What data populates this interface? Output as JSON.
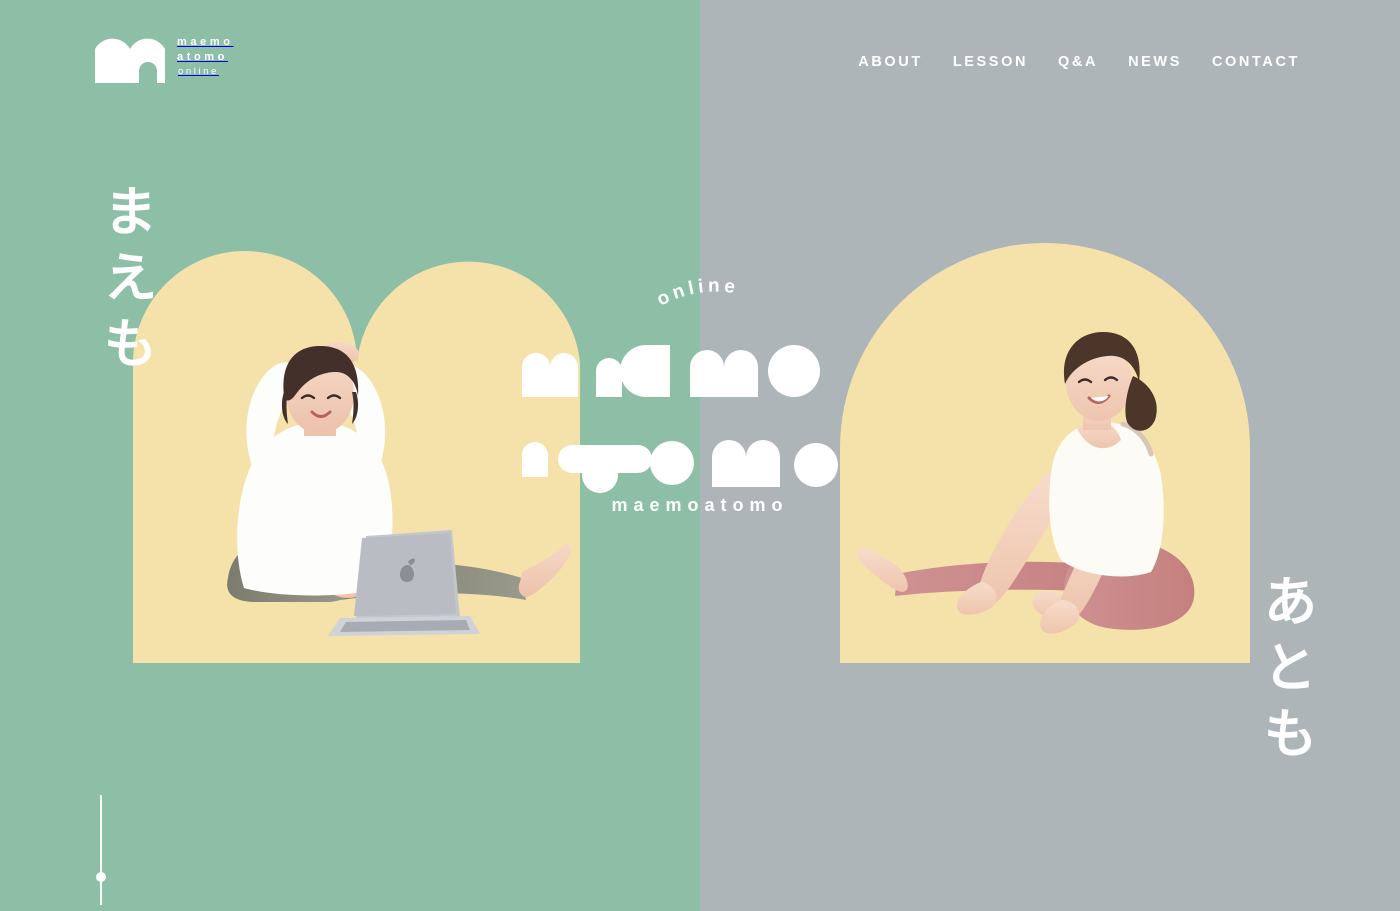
{
  "site": {
    "brand": {
      "logo_icon": "maemoatomo-arch-logo-icon",
      "line1": "maemo",
      "line2": "atomo",
      "line3": "online"
    },
    "nav": [
      {
        "label": "ABOUT"
      },
      {
        "label": "LESSON"
      },
      {
        "label": "Q&A"
      },
      {
        "label": "NEWS"
      },
      {
        "label": "CONTACT"
      }
    ]
  },
  "hero": {
    "logotype": {
      "arc_label": "online",
      "row1": "maemo",
      "row2": "atomo",
      "caption": "maemoatomo"
    },
    "vertical_left": "まえも",
    "vertical_right": "あとも",
    "left_photo_alt": "woman-stretching-with-laptop",
    "right_photo_alt": "woman-seated-side-stretch",
    "scroll_indicator": "scroll-down-line"
  },
  "colors": {
    "green": "#8cbfa6",
    "gray": "#aeb5b8",
    "yellow": "#f4e2aa",
    "white": "#ffffff"
  }
}
